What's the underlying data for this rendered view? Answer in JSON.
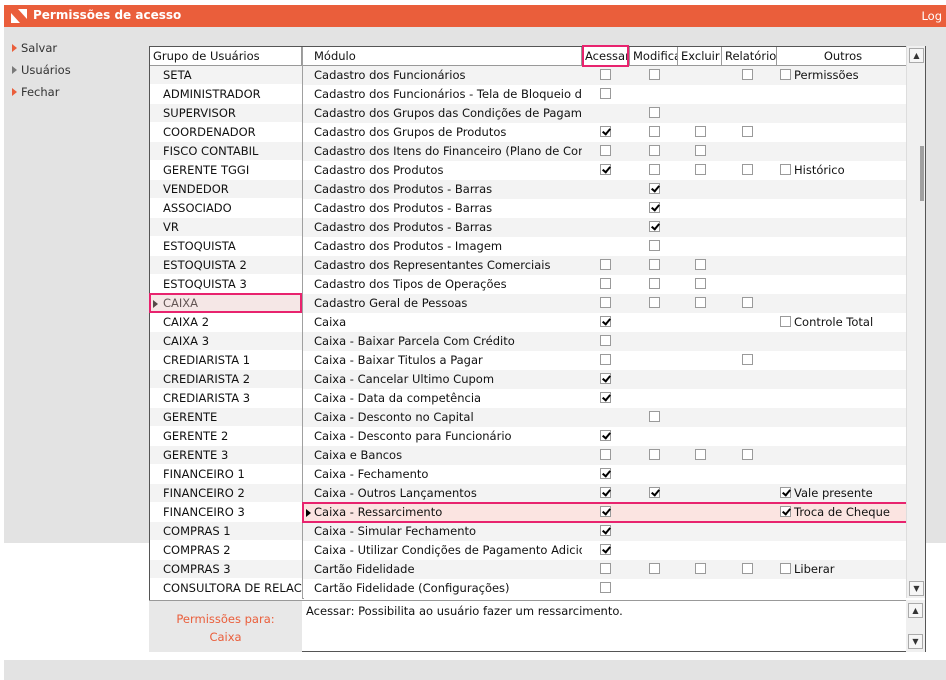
{
  "window": {
    "title": "Permissões de acesso",
    "logout": "Log"
  },
  "sidebar": {
    "items": [
      {
        "label": "Salvar",
        "icon": "arrow-right-icon"
      },
      {
        "label": "Usuários",
        "icon": "arrow-right-icon"
      },
      {
        "label": "Fechar",
        "icon": "arrow-right-icon"
      }
    ]
  },
  "groups": {
    "header": "Grupo de Usuários",
    "selected": "CAIXA",
    "items": [
      "SETA",
      "ADMINISTRADOR",
      "SUPERVISOR",
      "COORDENADOR",
      "FISCO CONTABIL",
      "GERENTE TGGI",
      "VENDEDOR",
      "ASSOCIADO",
      "VR",
      "ESTOQUISTA",
      "ESTOQUISTA 2",
      "ESTOQUISTA 3",
      "CAIXA",
      "CAIXA 2",
      "CAIXA 3",
      "CREDIARISTA 1",
      "CREDIARISTA 2",
      "CREDIARISTA 3",
      "GERENTE",
      "GERENTE 2",
      "GERENTE 3",
      "FINANCEIRO 1",
      "FINANCEIRO 2",
      "FINANCEIRO 3",
      "COMPRAS 1",
      "COMPRAS 2",
      "COMPRAS 3",
      "CONSULTORA DE RELACIO"
    ]
  },
  "modules": {
    "headers": {
      "modulo": "Módulo",
      "acessar": "Acessar",
      "modificar": "Modifica",
      "excluir": "Excluir",
      "relatorios": "Relatórios",
      "outros": "Outros"
    },
    "selected": "Caixa - Ressarcimento",
    "rows": [
      {
        "name": "Cadastro dos Funcionários",
        "a": [
          1,
          0
        ],
        "m": [
          1,
          0
        ],
        "e": null,
        "r": [
          1,
          0
        ],
        "o": {
          "label": "Permissões",
          "checked": false
        }
      },
      {
        "name": "Cadastro dos Funcionários - Tela de Bloqueio de Vendas",
        "a": [
          1,
          0
        ],
        "m": null,
        "e": null,
        "r": null,
        "o": null
      },
      {
        "name": "Cadastro dos Grupos das Condições de Pagamento",
        "a": null,
        "m": [
          1,
          0
        ],
        "e": null,
        "r": null,
        "o": null
      },
      {
        "name": "Cadastro dos Grupos de Produtos",
        "a": [
          1,
          1
        ],
        "m": [
          1,
          0
        ],
        "e": [
          1,
          0
        ],
        "r": [
          1,
          0
        ],
        "o": null
      },
      {
        "name": "Cadastro dos Itens do Financeiro (Plano de Contas)",
        "a": [
          1,
          0
        ],
        "m": [
          1,
          0
        ],
        "e": [
          1,
          0
        ],
        "r": null,
        "o": null
      },
      {
        "name": "Cadastro dos Produtos",
        "a": [
          1,
          1
        ],
        "m": [
          1,
          0
        ],
        "e": [
          1,
          0
        ],
        "r": [
          1,
          0
        ],
        "o": {
          "label": "Histórico",
          "checked": false
        }
      },
      {
        "name": "Cadastro dos Produtos - Barras",
        "a": null,
        "m": [
          1,
          1
        ],
        "e": null,
        "r": null,
        "o": null
      },
      {
        "name": "Cadastro dos Produtos - Barras",
        "a": null,
        "m": [
          1,
          1
        ],
        "e": null,
        "r": null,
        "o": null
      },
      {
        "name": "Cadastro dos Produtos - Barras",
        "a": null,
        "m": [
          1,
          1
        ],
        "e": null,
        "r": null,
        "o": null
      },
      {
        "name": "Cadastro dos Produtos - Imagem",
        "a": null,
        "m": [
          1,
          0
        ],
        "e": null,
        "r": null,
        "o": null
      },
      {
        "name": "Cadastro dos Representantes Comerciais",
        "a": [
          1,
          0
        ],
        "m": [
          1,
          0
        ],
        "e": [
          1,
          0
        ],
        "r": null,
        "o": null
      },
      {
        "name": "Cadastro dos Tipos de Operações",
        "a": [
          1,
          0
        ],
        "m": [
          1,
          0
        ],
        "e": [
          1,
          0
        ],
        "r": null,
        "o": null
      },
      {
        "name": "Cadastro Geral de Pessoas",
        "a": [
          1,
          0
        ],
        "m": [
          1,
          0
        ],
        "e": [
          1,
          0
        ],
        "r": [
          1,
          0
        ],
        "o": null
      },
      {
        "name": "Caixa",
        "a": [
          1,
          1
        ],
        "m": null,
        "e": null,
        "r": null,
        "o": {
          "label": "Controle Total",
          "checked": false
        }
      },
      {
        "name": "Caixa - Baixar Parcela Com Crédito",
        "a": [
          1,
          0
        ],
        "m": null,
        "e": null,
        "r": null,
        "o": null
      },
      {
        "name": "Caixa - Baixar Titulos a Pagar",
        "a": [
          1,
          0
        ],
        "m": null,
        "e": null,
        "r": [
          1,
          0
        ],
        "o": null
      },
      {
        "name": "Caixa - Cancelar Ultimo Cupom",
        "a": [
          1,
          1
        ],
        "m": null,
        "e": null,
        "r": null,
        "o": null
      },
      {
        "name": "Caixa - Data da competência",
        "a": [
          1,
          1
        ],
        "m": null,
        "e": null,
        "r": null,
        "o": null
      },
      {
        "name": "Caixa - Desconto no Capital",
        "a": null,
        "m": [
          1,
          0
        ],
        "e": null,
        "r": null,
        "o": null
      },
      {
        "name": "Caixa - Desconto para Funcionário",
        "a": [
          1,
          1
        ],
        "m": null,
        "e": null,
        "r": null,
        "o": null
      },
      {
        "name": "Caixa e Bancos",
        "a": [
          1,
          0
        ],
        "m": [
          1,
          0
        ],
        "e": [
          1,
          0
        ],
        "r": [
          1,
          0
        ],
        "o": null
      },
      {
        "name": "Caixa - Fechamento",
        "a": [
          1,
          1
        ],
        "m": null,
        "e": null,
        "r": null,
        "o": null
      },
      {
        "name": "Caixa - Outros Lançamentos",
        "a": [
          1,
          1
        ],
        "m": [
          1,
          1
        ],
        "e": null,
        "r": null,
        "o": {
          "label": "Vale presente",
          "checked": true
        }
      },
      {
        "name": "Caixa - Ressarcimento",
        "a": [
          1,
          1
        ],
        "m": null,
        "e": null,
        "r": null,
        "o": {
          "label": "Troca de Cheque",
          "checked": true
        }
      },
      {
        "name": "Caixa - Simular Fechamento",
        "a": [
          1,
          1
        ],
        "m": null,
        "e": null,
        "r": null,
        "o": null
      },
      {
        "name": "Caixa - Utilizar Condições de Pagamento Adicionais",
        "a": [
          1,
          1
        ],
        "m": null,
        "e": null,
        "r": null,
        "o": null
      },
      {
        "name": "Cartão Fidelidade",
        "a": [
          1,
          0
        ],
        "m": [
          1,
          0
        ],
        "e": [
          1,
          0
        ],
        "r": [
          1,
          0
        ],
        "o": {
          "label": "Liberar",
          "checked": false
        }
      },
      {
        "name": "Cartão Fidelidade (Configurações)",
        "a": [
          1,
          0
        ],
        "m": null,
        "e": null,
        "r": null,
        "o": null
      }
    ]
  },
  "footer": {
    "permissions_for_label": "Permissões para:",
    "permissions_for_value": "Caixa",
    "description": "Acessar: Possibilita ao usuário fazer um ressarcimento."
  },
  "colors": {
    "accent": "#ea5e3b",
    "highlight": "#e8236e"
  }
}
